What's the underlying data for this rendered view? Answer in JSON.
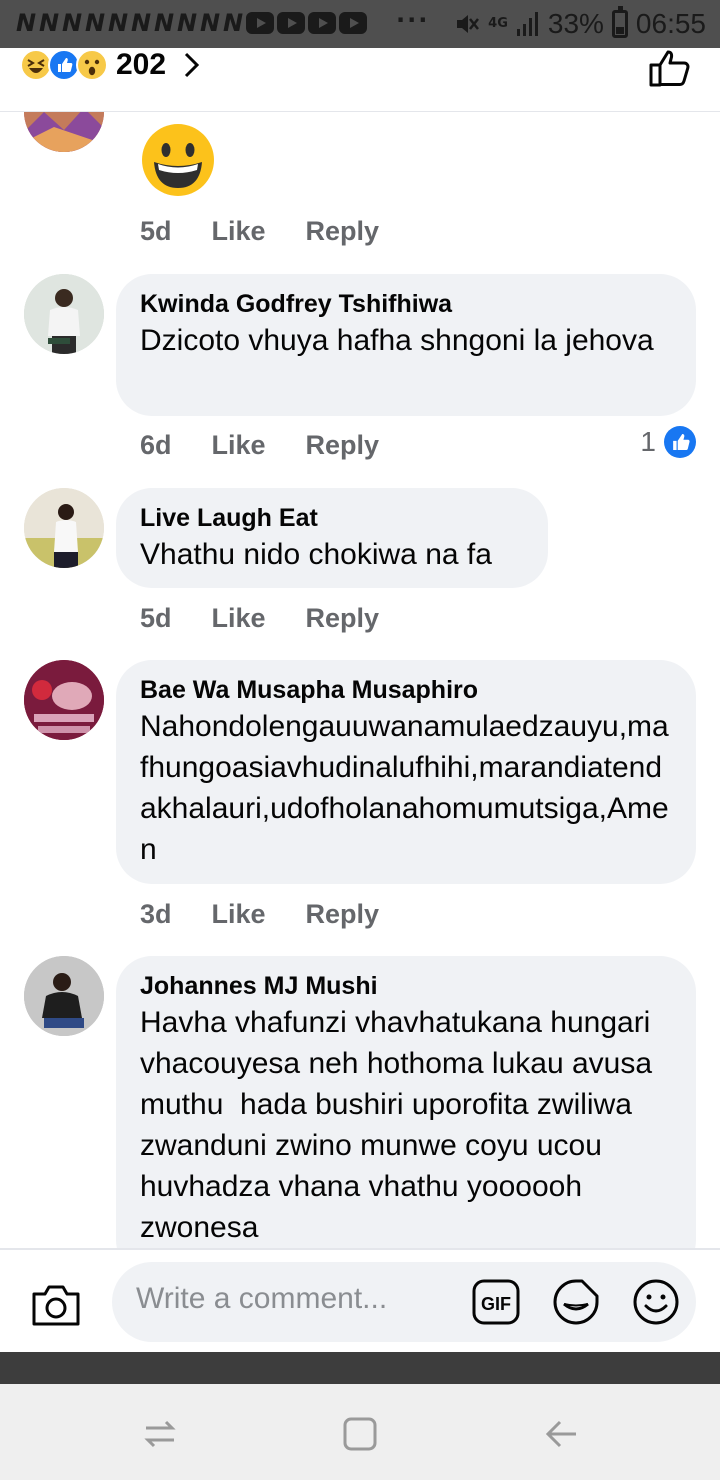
{
  "status_bar": {
    "battery": "33%",
    "time": "06:55",
    "network": "4G"
  },
  "reactions": {
    "types": [
      "haha-emoji-icon",
      "like-reaction-icon",
      "wow-emoji-icon"
    ],
    "count": "202"
  },
  "comments": [
    {
      "name": "",
      "text": "😀",
      "age": "5d",
      "like_label": "Like",
      "reply_label": "Reply",
      "likes": ""
    },
    {
      "name": "Kwinda Godfrey Tshifhiwa",
      "text": "Dzicoto vhuya hafha shngoni la jehova",
      "age": "6d",
      "like_label": "Like",
      "reply_label": "Reply",
      "likes": "1"
    },
    {
      "name": "Live Laugh Eat",
      "text": "Vhathu nido chokiwa na fa",
      "age": "5d",
      "like_label": "Like",
      "reply_label": "Reply",
      "likes": ""
    },
    {
      "name": "Bae Wa Musapha Musaphiro",
      "text": "Nahondolengauuwanamulaedzauyu,mafhungoasiavhudinalufhihi,marandiatendakhalauri,udofholanahomumutsiga,Amen",
      "age": "3d",
      "like_label": "Like",
      "reply_label": "Reply",
      "likes": ""
    },
    {
      "name": "Johannes MJ Mushi",
      "text": "Havha vhafunzi vhavhatukana hungari vhacouyesa neh hothoma lukau avusa muthu  hada bushiri uporofita zwiliwa zwanduni zwino munwe coyu ucou huvhadza vhana vhathu yoooooh zwonesa",
      "age": "",
      "like_label": "",
      "reply_label": "",
      "likes": ""
    }
  ],
  "composer": {
    "placeholder": "Write a comment..."
  },
  "colors": {
    "accent": "#1877f2",
    "bubble": "#f0f2f5",
    "meta_text": "#65676b"
  }
}
